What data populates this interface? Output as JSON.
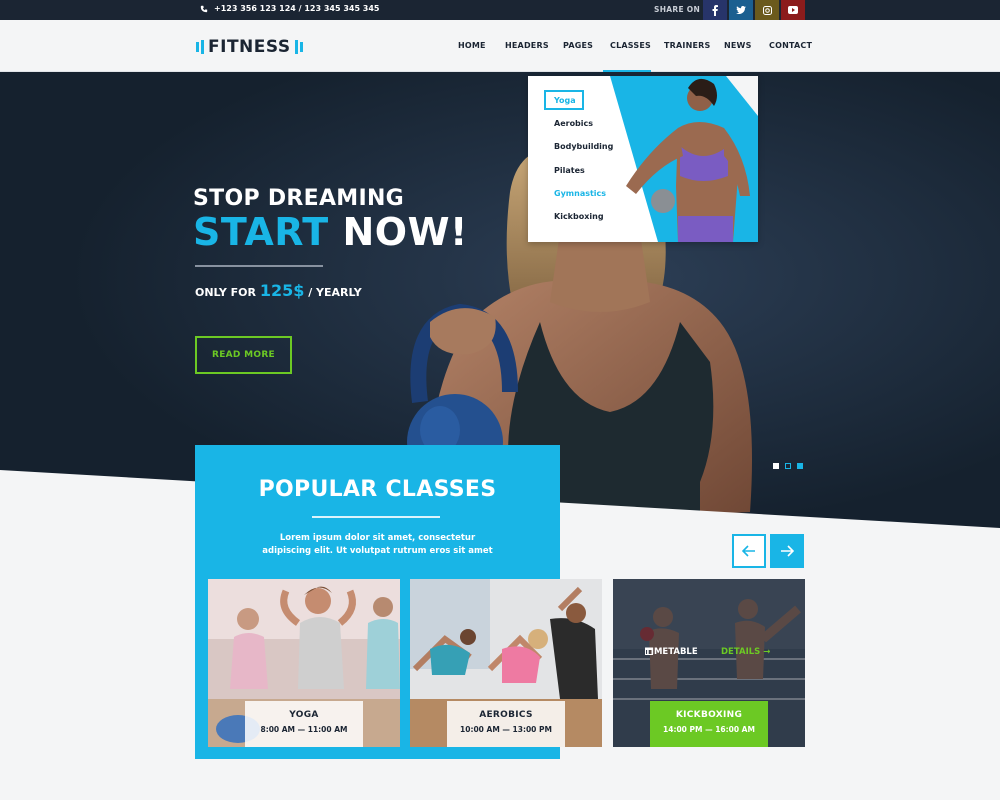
{
  "topbar": {
    "phone": "+123 356 123 124   / 123 345 345 345",
    "share_label": "SHARE ON",
    "social": [
      {
        "icon": "facebook-icon",
        "glyph": "f"
      },
      {
        "icon": "twitter-icon",
        "glyph": "t"
      },
      {
        "icon": "instagram-icon",
        "glyph": "◘"
      },
      {
        "icon": "youtube-icon",
        "glyph": "▶"
      }
    ]
  },
  "brand": {
    "name": "FITNESS"
  },
  "nav": {
    "items": [
      "HOME",
      "HEADERS",
      "PAGES",
      "CLASSES",
      "TRAINERS",
      "NEWS",
      "CONTACT"
    ],
    "active": "CLASSES"
  },
  "dropdown": {
    "items": [
      "Yoga",
      "Aerobics",
      "Bodybuilding",
      "Pilates",
      "Gymnastics",
      "Kickboxing"
    ],
    "selected": "Yoga",
    "hover": "Gymnastics"
  },
  "hero": {
    "line1": "STOP DREAMING",
    "line2_accent": "START",
    "line2_rest": " NOW!",
    "price_prefix": "ONLY FOR ",
    "price": "125$",
    "price_suffix": " / YEARLY",
    "button": "READ MORE",
    "slides": 3,
    "active_slide": 3
  },
  "popular": {
    "title": "POPULAR CLASSES",
    "desc_line1": "Lorem ipsum dolor sit amet, consectetur",
    "desc_line2": "adipiscing elit. Ut volutpat rutrum eros sit amet"
  },
  "classes": [
    {
      "name": "YOGA",
      "time": "8:00 AM — 11:00 AM"
    },
    {
      "name": "AEROBICS",
      "time": "10:00 AM — 13:00 PM"
    },
    {
      "name": "KICKBOXING",
      "time": "14:00 PM — 16:00 AM",
      "timetable": "TIMETABLE",
      "details": "DETAILS →"
    }
  ],
  "colors": {
    "accent": "#19b5e6",
    "green": "#6cc924",
    "dark": "#1b2533"
  }
}
